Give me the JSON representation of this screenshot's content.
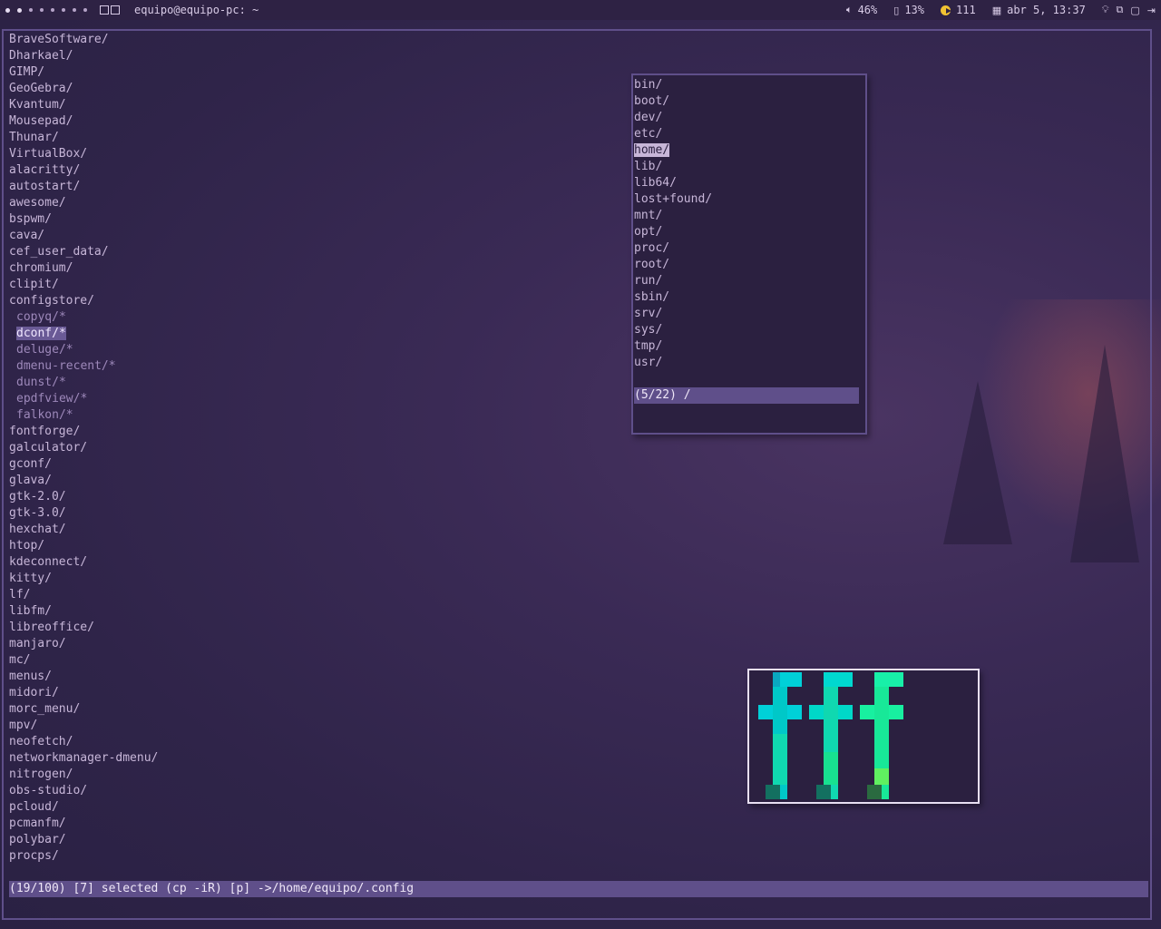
{
  "topbar": {
    "window_title": "equipo@equipo-pc: ~",
    "volume": "46%",
    "battery": "13%",
    "updates": "111",
    "datetime": "abr  5, 13:37"
  },
  "file_list": [
    "BraveSoftware/",
    "Dharkael/",
    "GIMP/",
    "GeoGebra/",
    "Kvantum/",
    "Mousepad/",
    "Thunar/",
    "VirtualBox/",
    "alacritty/",
    "autostart/",
    "awesome/",
    "bspwm/",
    "cava/",
    "cef_user_data/",
    "chromium/",
    "clipit/",
    "configstore/",
    "copyq/*",
    "dconf/*",
    "deluge/*",
    "dmenu-recent/*",
    "dunst/*",
    "epdfview/*",
    "falkon/*",
    "fontforge/",
    "galculator/",
    "gconf/",
    "glava/",
    "gtk-2.0/",
    "gtk-3.0/",
    "hexchat/",
    "htop/",
    "kdeconnect/",
    "kitty/",
    "lf/",
    "libfm/",
    "libreoffice/",
    "manjaro/",
    "mc/",
    "menus/",
    "midori/",
    "morc_menu/",
    "mpv/",
    "neofetch/",
    "networkmanager-dmenu/",
    "nitrogen/",
    "obs-studio/",
    "pcloud/",
    "pcmanfm/",
    "polybar/",
    "procps/"
  ],
  "status_line": "(19/100) [7] selected (cp -iR) [p] ->/home/equipo/.config",
  "popup": {
    "dirs": [
      "bin/",
      "boot/",
      "dev/",
      "etc/",
      "home/",
      "lib/",
      "lib64/",
      "lost+found/",
      "mnt/",
      "opt/",
      "proc/",
      "root/",
      "run/",
      "sbin/",
      "srv/",
      "sys/",
      "tmp/",
      "usr/"
    ],
    "prompt": "(5/22) /"
  },
  "colors": {
    "accent": "#5f4f8a",
    "text": "#c7b6d8",
    "preview_cyan": "#00d8d8",
    "preview_green": "#18f098"
  },
  "icons": [
    "volume-icon",
    "battery-icon",
    "updates-icon",
    "calendar-icon",
    "lightbulb-icon",
    "network-icon",
    "clipboard-icon",
    "logout-icon"
  ]
}
